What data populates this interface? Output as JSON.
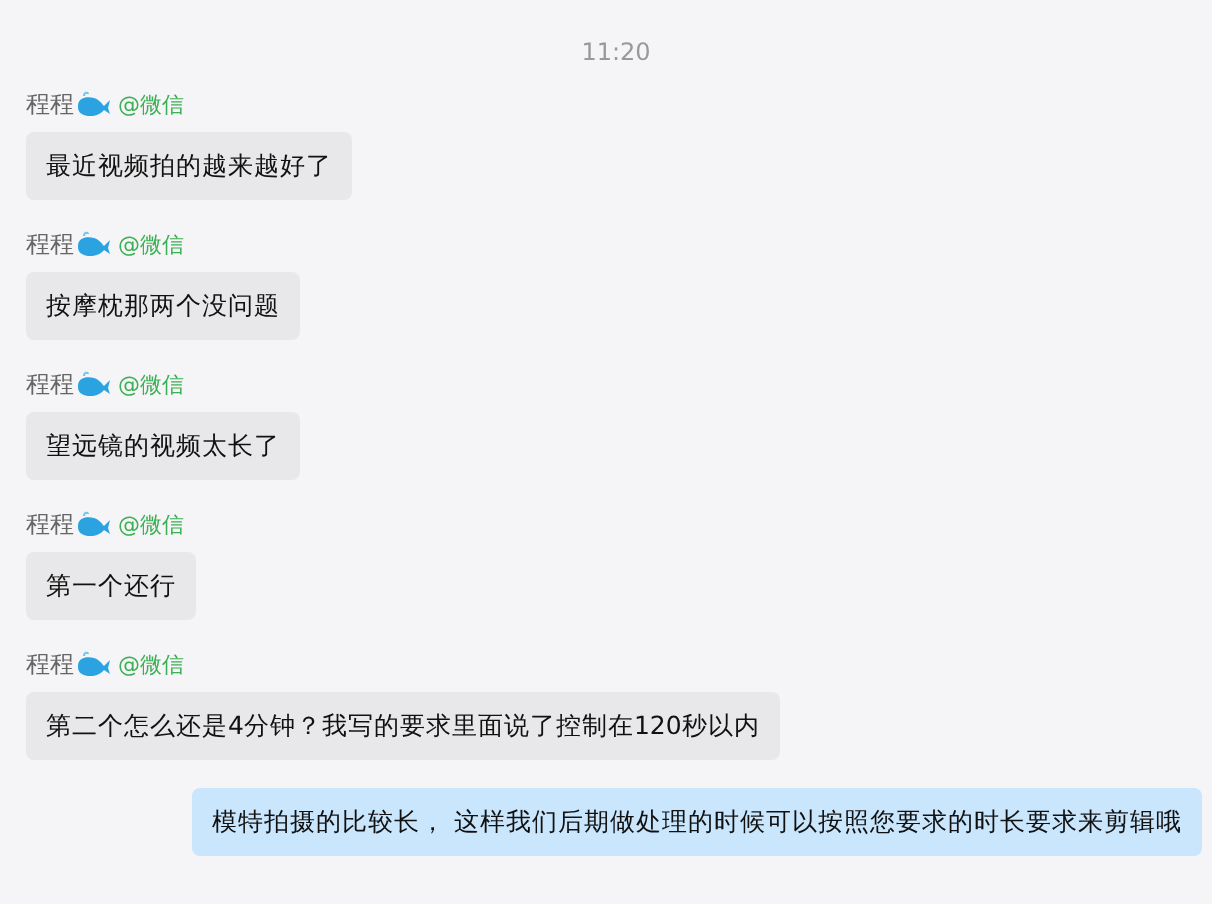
{
  "time": "11:20",
  "messages": [
    {
      "kind": "incoming",
      "sender": "程程",
      "source": "@微信",
      "text": "最近视频拍的越来越好了"
    },
    {
      "kind": "incoming",
      "sender": "程程",
      "source": "@微信",
      "text": "按摩枕那两个没问题"
    },
    {
      "kind": "incoming",
      "sender": "程程",
      "source": "@微信",
      "text": "望远镜的视频太长了"
    },
    {
      "kind": "incoming",
      "sender": "程程",
      "source": "@微信",
      "text": "第一个还行"
    },
    {
      "kind": "incoming",
      "sender": "程程",
      "source": "@微信",
      "text": "第二个怎么还是4分钟？我写的要求里面说了控制在120秒以内"
    },
    {
      "kind": "outgoing",
      "text": "模特拍摄的比较长， 这样我们后期做处理的时候可以按照您要求的时长要求来剪辑哦"
    }
  ]
}
